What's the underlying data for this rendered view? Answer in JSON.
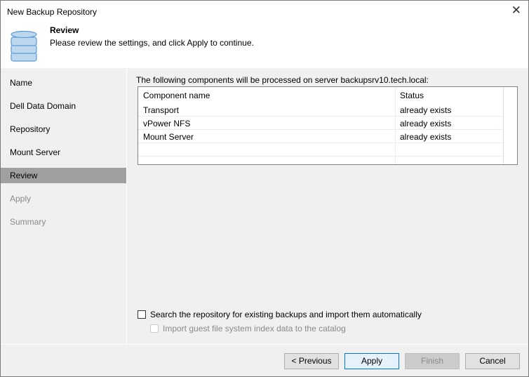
{
  "window": {
    "title": "New Backup Repository"
  },
  "header": {
    "title": "Review",
    "subtitle": "Please review the settings, and click Apply to continue."
  },
  "nav": [
    {
      "label": "Name",
      "state": "done"
    },
    {
      "label": "Dell Data Domain",
      "state": "done"
    },
    {
      "label": "Repository",
      "state": "done"
    },
    {
      "label": "Mount Server",
      "state": "done"
    },
    {
      "label": "Review",
      "state": "active"
    },
    {
      "label": "Apply",
      "state": "disabled"
    },
    {
      "label": "Summary",
      "state": "disabled"
    }
  ],
  "main": {
    "intro": "The following components will be processed on server backupsrv10.tech.local:",
    "columns": [
      "Component name",
      "Status"
    ],
    "rows": [
      {
        "name": "Transport",
        "status": "already exists"
      },
      {
        "name": "vPower NFS",
        "status": "already exists"
      },
      {
        "name": "Mount Server",
        "status": "already exists"
      }
    ],
    "search_checkbox": {
      "label": "Search the repository for existing backups and import them automatically",
      "checked": false
    },
    "index_checkbox": {
      "label": "Import guest file system index data to the catalog",
      "checked": false,
      "disabled": true
    }
  },
  "footer": {
    "previous": "< Previous",
    "apply": "Apply",
    "finish": "Finish",
    "cancel": "Cancel"
  }
}
